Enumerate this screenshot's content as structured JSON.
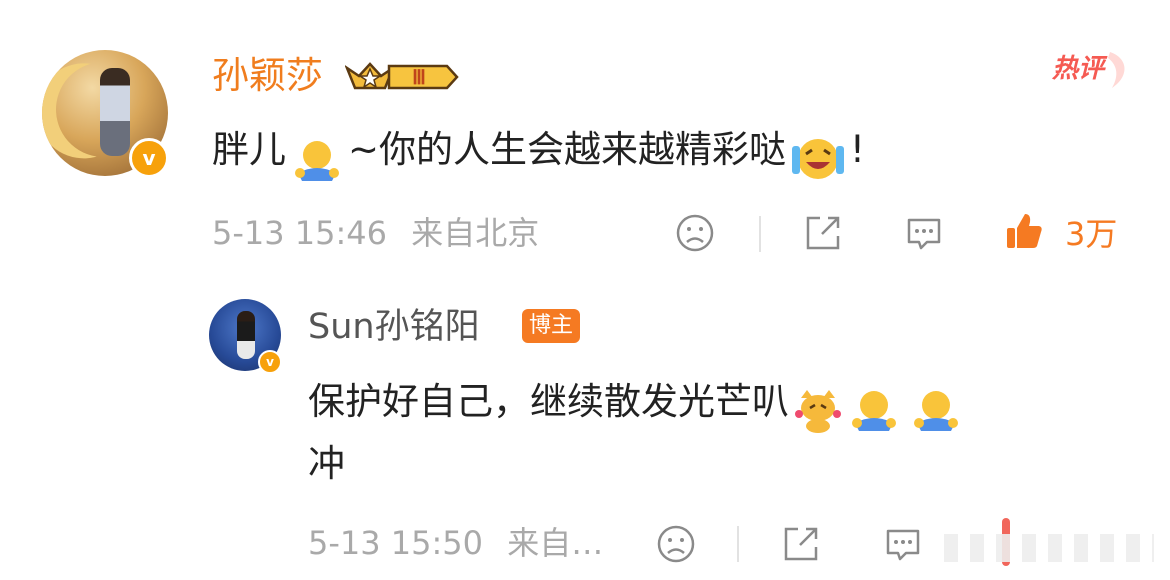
{
  "comment": {
    "author": "孙颖莎",
    "level_badge": "Ⅲ",
    "hot_label": "热评",
    "text_part1": "胖儿",
    "text_part2": "~你的人生会越来越精彩哒",
    "text_part3": "!",
    "timestamp": "5-13 15:46",
    "location": "来自北京",
    "likes": "3万"
  },
  "reply": {
    "author": "Sun孙铭阳",
    "owner_badge": "博主",
    "text_line1": "保护好自己，继续散发光芒叭",
    "text_line2": "冲",
    "timestamp": "5-13 15:50",
    "location": "来自…"
  },
  "colors": {
    "accent_orange": "#f57a22",
    "name_orange": "#f07d1e",
    "hot_red": "#f55a52",
    "meta_gray": "#a9a9a9",
    "verified_gold": "#f7a10b"
  },
  "icons": [
    "sad-face-icon",
    "share-icon",
    "comment-icon",
    "thumbs-up-icon",
    "crown-icon",
    "verified-icon",
    "hug-emoji",
    "laugh-cry-emoji",
    "cat-emoji"
  ]
}
